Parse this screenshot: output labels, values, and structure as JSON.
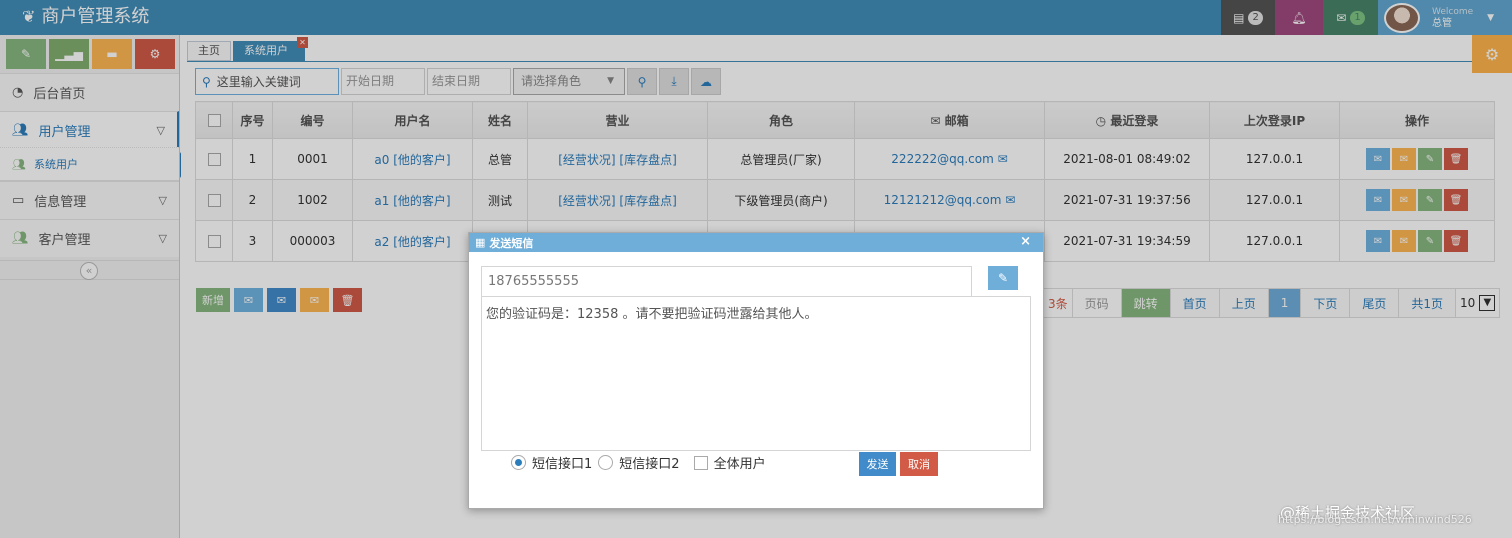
{
  "app": {
    "title": "商户管理系统"
  },
  "topnav": {
    "tasks_count": "2",
    "messages_count": "1",
    "colors": {
      "tasks": "#555555",
      "notify": "#a0487f",
      "messages": "#48866a",
      "user": "#62a8d1",
      "header": "#438eb9"
    }
  },
  "user": {
    "welcome": "Welcome",
    "name": "总管"
  },
  "sidebar": {
    "items": [
      {
        "label": "后台首页",
        "icon": "dashboard-icon"
      },
      {
        "label": "用户管理",
        "icon": "users-icon"
      },
      {
        "label": "信息管理",
        "icon": "credit-card-icon"
      },
      {
        "label": "客户管理",
        "icon": "group-icon"
      }
    ],
    "sub_item": "系统用户",
    "collapse": "«"
  },
  "tabs": [
    {
      "label": "主页"
    },
    {
      "label": "系统用户"
    }
  ],
  "toolbar": {
    "search_placeholder": "这里输入关键词",
    "start_date": "开始日期",
    "end_date": "结束日期",
    "role_placeholder": "请选择角色"
  },
  "table": {
    "headers": [
      "序号",
      "编号",
      "用户名",
      "姓名",
      "营业",
      "角色",
      "邮箱",
      "最近登录",
      "上次登录IP",
      "操作"
    ],
    "rows": [
      {
        "idx": "1",
        "code": "0001",
        "username": "a0 [他的客户]",
        "name": "总管",
        "biz": "[经营状况] [库存盘点]",
        "role": "总管理员(厂家)",
        "email": "222222@qq.com",
        "login": "2021-08-01 08:49:02",
        "ip": "127.0.0.1"
      },
      {
        "idx": "2",
        "code": "1002",
        "username": "a1 [他的客户]",
        "name": "测试",
        "biz": "[经营状况] [库存盘点]",
        "role": "下级管理员(商户)",
        "email": "12121212@qq.com",
        "login": "2021-07-31 19:37:56",
        "ip": "127.0.0.1"
      },
      {
        "idx": "3",
        "code": "000003",
        "username": "a2 [他的客户]",
        "name": "",
        "biz": "",
        "role": "",
        "email": "",
        "login": "2021-07-31 19:34:59",
        "ip": "127.0.0.1"
      }
    ]
  },
  "bottom": {
    "add": "新增"
  },
  "pager": {
    "total_suffix": "3条",
    "page_input": "页码",
    "jump": "跳转",
    "first": "首页",
    "prev": "上页",
    "current": "1",
    "next": "下页",
    "last": "尾页",
    "total_pages": "共1页",
    "page_size": "10"
  },
  "dialog": {
    "title": "发送短信",
    "phone": "18765555555",
    "message": "您的验证码是：12358 。请不要把验证码泄露给其他人。",
    "option1": "短信接口1",
    "option2": "短信接口2",
    "option3": "全体用户",
    "send": "发送",
    "cancel": "取消"
  },
  "watermark": {
    "text": "@稀土掘金技术社区",
    "url": "https://blog.csdn.net/wininwind526"
  }
}
